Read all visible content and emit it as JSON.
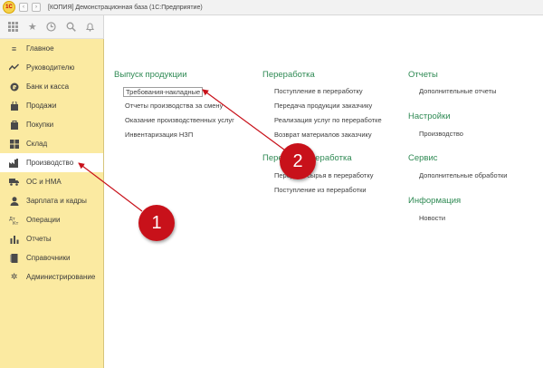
{
  "window": {
    "logo_text": "1С",
    "title": "[КОПИЯ] Демонстрационная база  (1С:Предприятие)"
  },
  "toolbar": {
    "icons": [
      "apps-icon",
      "star-icon",
      "history-icon",
      "search-icon",
      "bell-icon"
    ]
  },
  "sidebar": {
    "items": [
      {
        "label": "Главное",
        "icon": "home-icon"
      },
      {
        "label": "Руководителю",
        "icon": "trend-icon"
      },
      {
        "label": "Банк и касса",
        "icon": "bank-icon"
      },
      {
        "label": "Продажи",
        "icon": "sales-icon"
      },
      {
        "label": "Покупки",
        "icon": "cart-icon"
      },
      {
        "label": "Склад",
        "icon": "warehouse-icon"
      },
      {
        "label": "Производство",
        "icon": "factory-icon",
        "active": true
      },
      {
        "label": "ОС и НМА",
        "icon": "truck-icon"
      },
      {
        "label": "Зарплата и кадры",
        "icon": "person-icon"
      },
      {
        "label": "Операции",
        "icon": "operations-icon"
      },
      {
        "label": "Отчеты",
        "icon": "report-icon"
      },
      {
        "label": "Справочники",
        "icon": "book-icon"
      },
      {
        "label": "Администрирование",
        "icon": "gear-icon"
      }
    ]
  },
  "sections": {
    "vypusk": {
      "title": "Выпуск продукции",
      "links": [
        "Требования-накладные",
        "Отчеты производства за смену",
        "Оказание производственных услуг",
        "Инвентаризация НЗП"
      ]
    },
    "pererabotka": {
      "title": "Переработка",
      "links": [
        "Поступление в переработку",
        "Передача продукции заказчику",
        "Реализация услуг по переработке",
        "Возврат материалов заказчику"
      ]
    },
    "pererabotka2": {
      "title": "Переработка",
      "title_prefix": "Пере",
      "title_suffix": "ереработка",
      "links": [
        "Передача сырья в переработку",
        "Поступление из переработки"
      ]
    },
    "otchety": {
      "title": "Отчеты",
      "links": [
        "Дополнительные отчеты"
      ]
    },
    "nastroiki": {
      "title": "Настройки",
      "links": [
        "Производство"
      ]
    },
    "servis": {
      "title": "Сервис",
      "links": [
        "Дополнительные обработки"
      ]
    },
    "informaciya": {
      "title": "Информация",
      "links": [
        "Новости"
      ]
    }
  },
  "annotations": {
    "badge1": "1",
    "badge2": "2",
    "color": "#c8111a"
  }
}
